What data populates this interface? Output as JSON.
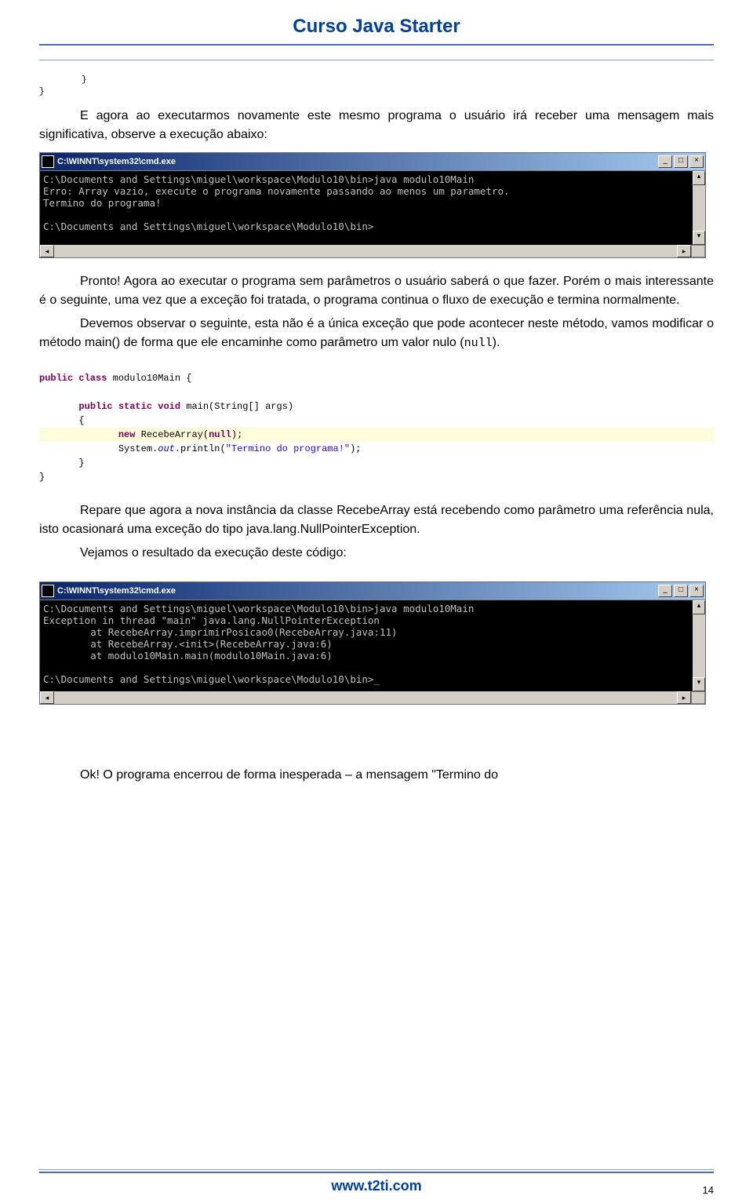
{
  "header": {
    "title": "Curso Java Starter"
  },
  "braces": {
    "b1": "}",
    "b2": "}"
  },
  "para1": "E agora ao executarmos novamente este mesmo programa o usuário irá receber uma mensagem mais significativa, observe a execução abaixo:",
  "cmd1": {
    "title": "C:\\WINNT\\system32\\cmd.exe",
    "lines": "C:\\Documents and Settings\\miguel\\workspace\\Modulo10\\bin>java modulo10Main\nErro: Array vazio, execute o programa novamente passando ao menos um parametro.\nTermino do programa!\n\nC:\\Documents and Settings\\miguel\\workspace\\Modulo10\\bin>"
  },
  "para2": "Pronto! Agora ao executar o programa sem parâmetros o usuário saberá o que fazer. Porém o mais interessante é o seguinte, uma vez que a exceção foi tratada, o programa continua o fluxo de execução e termina normalmente.",
  "para3_a": "Devemos observar o seguinte, esta não é a única exceção que pode acontecer neste método, vamos modificar o método main() de forma que ele encaminhe como parâmetro um valor nulo (",
  "para3_b": "null",
  "para3_c": ").",
  "code": {
    "l1": "public class",
    "l1b": " modulo10Main {",
    "l2a": "public static void",
    "l2b": " main(String[] args)",
    "l3": "{",
    "l4a": "new",
    "l4b": " RecebeArray(",
    "l4c": "null",
    "l4d": ");",
    "l5a": "System.",
    "l5b": "out",
    "l5c": ".println(",
    "l5d": "\"Termino do programa!\"",
    "l5e": ");",
    "l6": "}",
    "l7": "}"
  },
  "para4": "Repare que agora a nova instância da classe RecebeArray está recebendo como parâmetro uma referência nula, isto ocasionará uma exceção do tipo java.lang.NullPointerException.",
  "para5": "Vejamos o resultado da execução deste código:",
  "cmd2": {
    "title": "C:\\WINNT\\system32\\cmd.exe",
    "lines": "C:\\Documents and Settings\\miguel\\workspace\\Modulo10\\bin>java modulo10Main\nException in thread \"main\" java.lang.NullPointerException\n        at RecebeArray.imprimirPosicao0(RecebeArray.java:11)\n        at RecebeArray.<init>(RecebeArray.java:6)\n        at modulo10Main.main(modulo10Main.java:6)\n\nC:\\Documents and Settings\\miguel\\workspace\\Modulo10\\bin>_"
  },
  "para6": "Ok! O programa encerrou de forma inesperada – a mensagem \"Termino do",
  "footer": {
    "url": "www.t2ti.com",
    "page": "14"
  }
}
